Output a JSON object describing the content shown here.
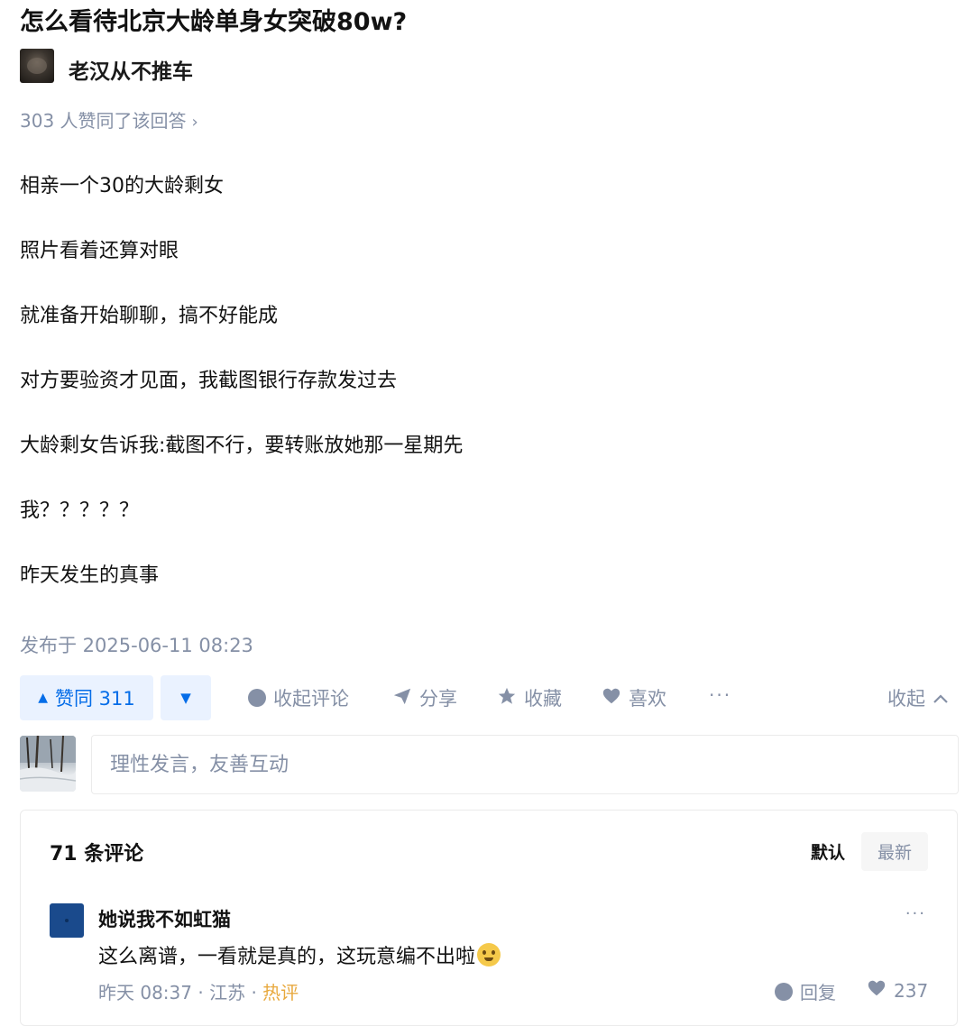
{
  "question": {
    "title": "怎么看待北京大龄单身女突破80w?"
  },
  "author": {
    "name": "老汉从不推车"
  },
  "upvote_summary": "303 人赞同了该回答",
  "answer": {
    "paragraphs": [
      "相亲一个30的大龄剩女",
      "照片看着还算对眼",
      "就准备开始聊聊，搞不好能成",
      "对方要验资才见面，我截图银行存款发过去",
      "大龄剩女告诉我:截图不行，要转账放她那一星期先",
      "我？？？？？",
      "昨天发生的真事"
    ],
    "published": "发布于 2025-06-11 08:23"
  },
  "actions": {
    "upvote_label": "赞同 311",
    "collapse_comments": "收起评论",
    "share": "分享",
    "favorite": "收藏",
    "like": "喜欢",
    "more": "···",
    "collapse": "收起"
  },
  "comment_input": {
    "placeholder": "理性发言，友善互动"
  },
  "comments": {
    "count_label": "71 条评论",
    "sort_default": "默认",
    "sort_newest": "最新",
    "items": [
      {
        "user": "她说我不如虹猫",
        "text": "这么离谱，一看就是真的，这玩意编不出啦",
        "time": "昨天 08:37",
        "location": "江苏",
        "tag": "热评",
        "reply_label": "回复",
        "likes": "237"
      }
    ]
  },
  "colors": {
    "accent": "#056de8",
    "muted": "#8590a6",
    "hot": "#e8a93e"
  }
}
